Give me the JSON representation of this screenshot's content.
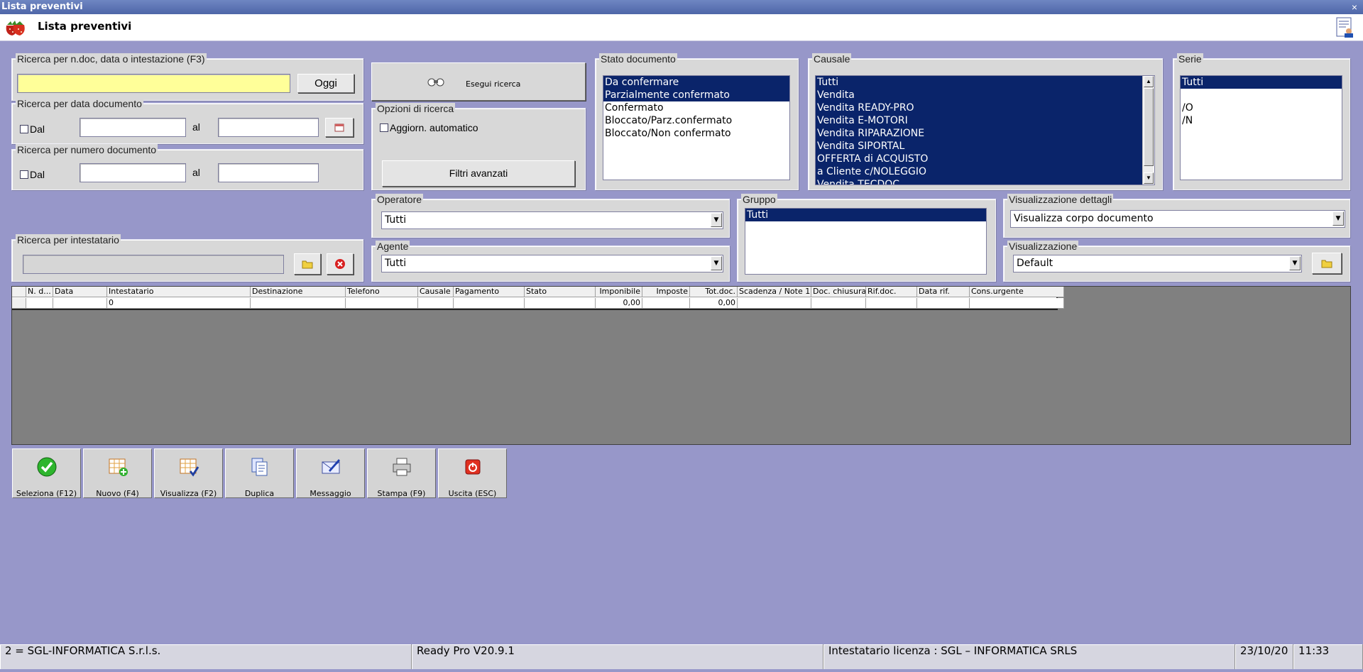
{
  "window": {
    "title": "Lista preventivi",
    "close_glyph": "×"
  },
  "header": {
    "title": "Lista preventivi",
    "logo_icon": "strawberry-logo-icon",
    "user_icon": "user-settings-icon"
  },
  "search_doc": {
    "label": "Ricerca per n.doc, data o intestazione (F3)",
    "value": "",
    "oggi_label": "Oggi"
  },
  "search_date": {
    "label": "Ricerca per data documento",
    "dal_label": "Dal",
    "al_label": "al",
    "from": "",
    "to": "",
    "checked": false
  },
  "search_number": {
    "label": "Ricerca per numero documento",
    "dal_label": "Dal",
    "al_label": "al",
    "from": "",
    "to": "",
    "checked": false
  },
  "search_holder": {
    "label": "Ricerca per intestatario",
    "value": ""
  },
  "run_search": {
    "label": "Esegui ricerca",
    "icon": "binoculars-icon"
  },
  "search_options": {
    "label": "Opzioni di ricerca",
    "auto_update_label": "Aggiorn. automatico",
    "auto_update": false,
    "advanced_filters_label": "Filtri avanzati"
  },
  "doc_status": {
    "label": "Stato documento",
    "items": [
      {
        "label": "Da confermare",
        "selected": true
      },
      {
        "label": "Parzialmente confermato",
        "selected": true
      },
      {
        "label": "Confermato",
        "selected": false
      },
      {
        "label": "Bloccato/Parz.confermato",
        "selected": false
      },
      {
        "label": "Bloccato/Non confermato",
        "selected": false
      }
    ]
  },
  "causale": {
    "label": "Causale",
    "items": [
      {
        "label": "Tutti",
        "selected": true
      },
      {
        "label": "Vendita",
        "selected": true
      },
      {
        "label": "Vendita READY-PRO",
        "selected": true
      },
      {
        "label": "Vendita E-MOTORI",
        "selected": true
      },
      {
        "label": "Vendita RIPARAZIONE",
        "selected": true
      },
      {
        "label": "Vendita SIPORTAL",
        "selected": true
      },
      {
        "label": "OFFERTA di ACQUISTO",
        "selected": true
      },
      {
        "label": "a Cliente c/NOLEGGIO",
        "selected": true
      },
      {
        "label": "Vendita TECDOC",
        "selected": true
      }
    ]
  },
  "serie": {
    "label": "Serie",
    "items": [
      {
        "label": "Tutti",
        "selected": true
      },
      {
        "label": "",
        "selected": false
      },
      {
        "label": "/O",
        "selected": false
      },
      {
        "label": "/N",
        "selected": false
      }
    ]
  },
  "operatore": {
    "label": "Operatore",
    "value": "Tutti"
  },
  "agente": {
    "label": "Agente",
    "value": "Tutti"
  },
  "gruppo": {
    "label": "Gruppo",
    "items": [
      {
        "label": "Tutti",
        "selected": true
      }
    ]
  },
  "details_view": {
    "label": "Visualizzazione dettagli",
    "value": "Visualizza corpo documento"
  },
  "view": {
    "label": "Visualizzazione",
    "value": "Default"
  },
  "table": {
    "columns": [
      "N. d...",
      "Data",
      "Intestatario",
      "Destinazione",
      "Telefono",
      "Causale",
      "Pagamento",
      "Stato",
      "Imponibile",
      "Imposte",
      "Tot.doc.",
      "Scadenza / Note 1",
      "Doc. chiusura",
      "Rif.doc.",
      "Data rif.",
      "Cons.urgente"
    ],
    "rows": [
      [
        "",
        "",
        "0",
        "",
        "",
        "",
        "",
        "",
        "0,00",
        "",
        "0,00",
        "",
        "",
        "",
        "",
        ""
      ]
    ]
  },
  "toolbar": [
    {
      "label": "Seleziona (F12)",
      "icon": "checkmark-icon"
    },
    {
      "label": "Nuovo (F4)",
      "icon": "new-document-icon"
    },
    {
      "label": "Visualizza (F2)",
      "icon": "view-document-icon"
    },
    {
      "label": "Duplica",
      "icon": "duplicate-icon"
    },
    {
      "label": "Messaggio",
      "icon": "message-icon"
    },
    {
      "label": "Stampa (F9)",
      "icon": "printer-icon"
    },
    {
      "label": "Uscita (ESC)",
      "icon": "exit-icon"
    }
  ],
  "status": {
    "company": "2 = SGL-INFORMATICA S.r.l.s.",
    "version": "Ready Pro V20.9.1",
    "license": "Intestatario licenza : SGL – INFORMATICA SRLS",
    "date": "23/10/20",
    "time": "11:33"
  },
  "colors": {
    "background": "#9797c9",
    "selection": "#0a246a",
    "search_field": "#ffff99"
  }
}
